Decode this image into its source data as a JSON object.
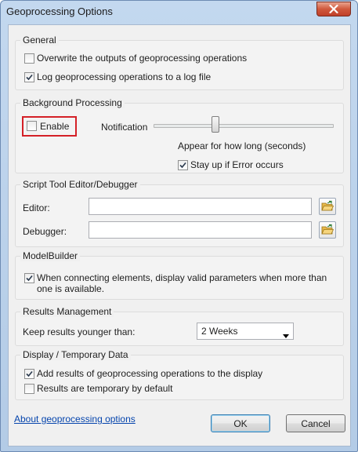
{
  "window": {
    "title": "Geoprocessing Options"
  },
  "general": {
    "title": "General",
    "overwrite": {
      "label": "Overwrite the outputs of geoprocessing operations",
      "checked": false
    },
    "log": {
      "label": "Log geoprocessing operations to a log file",
      "checked": true
    }
  },
  "background": {
    "title": "Background Processing",
    "enable": {
      "label": "Enable",
      "checked": false
    },
    "notification_label": "Notification",
    "slider_caption": "Appear for how long (seconds)",
    "stay_up": {
      "label": "Stay up if Error occurs",
      "checked": true
    }
  },
  "script": {
    "title": "Script Tool Editor/Debugger",
    "editor_label": "Editor:",
    "editor_value": "",
    "debugger_label": "Debugger:",
    "debugger_value": ""
  },
  "modelbuilder": {
    "title": "ModelBuilder",
    "valid_params": {
      "label": "When connecting elements, display valid parameters when more than one is available.",
      "checked": true
    }
  },
  "results": {
    "title": "Results Management",
    "keep_label": "Keep results younger than:",
    "keep_value": "2 Weeks"
  },
  "display": {
    "title": "Display / Temporary Data",
    "add_results": {
      "label": "Add results of geoprocessing operations to the display",
      "checked": true
    },
    "temporary": {
      "label": "Results are temporary by default",
      "checked": false
    }
  },
  "footer": {
    "about_link": "About geoprocessing options",
    "ok_label": "OK",
    "cancel_label": "Cancel"
  },
  "colors": {
    "highlight": "#d42027",
    "link": "#0645ad",
    "titlebar": "#c3d8ef",
    "close_button": "#d0593c"
  }
}
